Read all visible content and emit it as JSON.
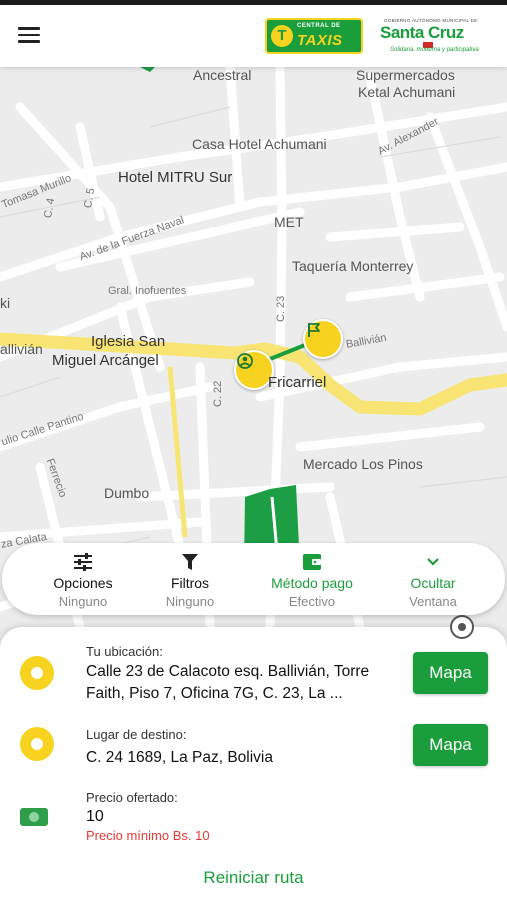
{
  "header": {
    "menu_icon": "hamburger-icon",
    "logo_taxis_small": "CENTRAL DE",
    "logo_taxis_big": "TAXIS",
    "logo_sc_top": "GOBIERNO AUTÓNOMO MUNICIPAL DE",
    "logo_sc_main": "Santa Cruz",
    "logo_sc_sub": "Solidaria, moderna y participativa"
  },
  "map": {
    "labels": {
      "ancestral": "Ancestral",
      "supermercados": "Supermercados",
      "ketal": "Ketal Achumani",
      "casa_hotel": "Casa Hotel Achumani",
      "av_alexander": "Av. Alexander",
      "hotel_mitru": "Hotel MITRU Sur",
      "tomasa": "Tomasa Murillo",
      "c4": "C. 4",
      "c5": "C. 5",
      "fuerza_naval": "Av. de la Fuerza Naval",
      "met": "MET",
      "taqueria": "Taquería Monterrey",
      "inofuentes": "Gral. Inofuentes",
      "c23": "C. 23",
      "ki": "ki",
      "iglesia1": "Iglesia San",
      "iglesia2": "Miguel Arcángel",
      "ballivian_left": "allivián",
      "ballivian_right": "Ballivián",
      "fricarriel": "Fricarriel",
      "c22": "C. 22",
      "pantino": "ulio Calle Pantino",
      "ferrecio": "Ferrecio",
      "mercado": "Mercado Los Pinos",
      "dumbo": "Dumbo",
      "za_calatayud": "za Calata"
    }
  },
  "options": {
    "opciones": {
      "label": "Opciones",
      "value": "Ninguno",
      "icon": "sliders-icon"
    },
    "filtros": {
      "label": "Filtros",
      "value": "Ninguno",
      "icon": "filter-icon"
    },
    "metodo": {
      "label": "Método pago",
      "value": "Efectivo",
      "icon": "wallet-icon"
    },
    "ocultar": {
      "label": "Ocultar",
      "value": "Ventana",
      "icon": "chevron-down-icon"
    }
  },
  "trip": {
    "origin": {
      "caption": "Tu ubicación:",
      "address": "Calle 23 de Calacoto esq. Ballivián, Torre Faith, Piso 7, Oficina 7G, C. 23, La ...",
      "button": "Mapa"
    },
    "destination": {
      "caption": "Lugar de destino:",
      "address": "C. 24 1689, La Paz, Bolivia",
      "button": "Mapa"
    },
    "price": {
      "caption": "Precio ofertado:",
      "value": "10",
      "minimum": "Precio mínimo Bs. 10"
    },
    "reset": "Reiniciar ruta"
  },
  "colors": {
    "brand_green": "#1a9e3b",
    "brand_yellow": "#f7d21f",
    "alert_red": "#e53935"
  }
}
